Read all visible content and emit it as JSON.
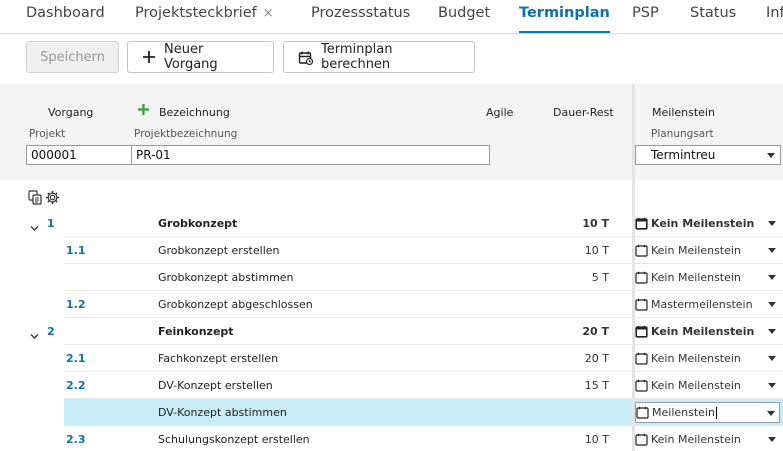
{
  "tabs": [
    {
      "label": "Dashboard"
    },
    {
      "label": "Projektsteckbrief",
      "close": "×"
    },
    {
      "label": "Prozessstatus"
    },
    {
      "label": "Budget"
    },
    {
      "label": "Terminplan",
      "active": true
    },
    {
      "label": "PSP"
    },
    {
      "label": "Status"
    },
    {
      "label": "Inf"
    }
  ],
  "toolbar": {
    "save_label": "Speichern",
    "new_task_label": "Neuer Vorgang",
    "calc_label": "Terminplan berechnen"
  },
  "columns": {
    "vorgang": "Vorgang",
    "bezeichnung": "Bezeichnung",
    "agile": "Agile",
    "dauer_rest": "Dauer-Rest",
    "meilenstein": "Meilenstein"
  },
  "project": {
    "projekt_label": "Projekt",
    "projekt_value": "000001",
    "bezeichnung_label": "Projektbezeichnung",
    "bezeichnung_value": "PR-01",
    "planungsart_label": "Planungsart",
    "planungsart_value": "Termintreu"
  },
  "rows": [
    {
      "num": "1",
      "name": "Grobkonzept",
      "dur": "10 T",
      "ms": "Kein Meilenstein",
      "bold": true,
      "expand": true
    },
    {
      "num": "1.1",
      "name": "Grobkonzept erstellen",
      "dur": "10 T",
      "ms": "Kein Meilenstein"
    },
    {
      "num": "",
      "name": "Grobkonzept abstimmen",
      "dur": "5 T",
      "ms": "Kein Meilenstein"
    },
    {
      "num": "1.2",
      "name": "Grobkonzept abgeschlossen",
      "dur": "",
      "ms": "Mastermeilenstein"
    },
    {
      "num": "2",
      "name": "Feinkonzept",
      "dur": "20 T",
      "ms": "Kein Meilenstein",
      "bold": true,
      "expand": true
    },
    {
      "num": "2.1",
      "name": "Fachkonzept erstellen",
      "dur": "20 T",
      "ms": "Kein Meilenstein"
    },
    {
      "num": "2.2",
      "name": "DV-Konzept erstellen",
      "dur": "15 T",
      "ms": "Kein Meilenstein"
    },
    {
      "num": "",
      "name": "DV-Konzept abstimmen",
      "dur": "",
      "ms": "Meilenstein",
      "selected": true
    },
    {
      "num": "2.3",
      "name": "Schulungskonzept erstellen",
      "dur": "10 T",
      "ms": "Kein Meilenstein"
    }
  ],
  "icons": {
    "plus": "plus-icon",
    "calendar": "calendar-icon",
    "copy": "copy-icon",
    "gear": "gear-icon",
    "chevron": "chevron-down-icon"
  },
  "colors": {
    "accent": "#0b73a8",
    "add_green": "#2e9e3e",
    "selection": "#c8ecf8"
  }
}
